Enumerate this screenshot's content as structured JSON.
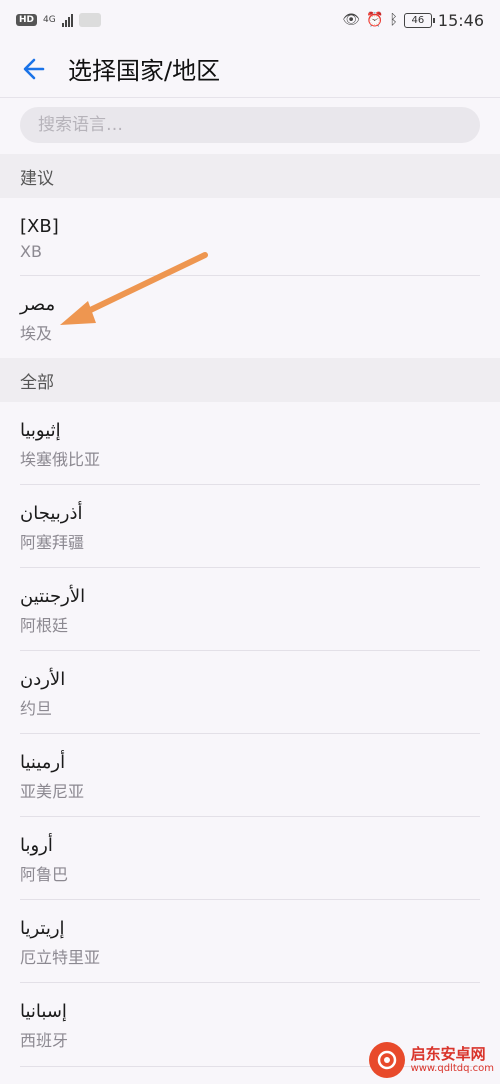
{
  "status_bar": {
    "hd_badge": "HD",
    "network_label": "4G",
    "battery_level": "46",
    "time": "15:46"
  },
  "header": {
    "title": "选择国家/地区"
  },
  "search": {
    "placeholder": "搜索语言…",
    "value": ""
  },
  "sections": {
    "suggested_label": "建议",
    "all_label": "全部"
  },
  "suggested_items": [
    {
      "primary": "[XB]",
      "secondary": "XB"
    },
    {
      "primary": "مصر",
      "secondary": "埃及"
    }
  ],
  "all_items": [
    {
      "primary": "إثيوبيا",
      "secondary": "埃塞俄比亚"
    },
    {
      "primary": "أذربيجان",
      "secondary": "阿塞拜疆"
    },
    {
      "primary": "الأرجنتين",
      "secondary": "阿根廷"
    },
    {
      "primary": "الأردن",
      "secondary": "约旦"
    },
    {
      "primary": "أرمينيا",
      "secondary": "亚美尼亚"
    },
    {
      "primary": "أروبا",
      "secondary": "阿鲁巴"
    },
    {
      "primary": "إريتريا",
      "secondary": "厄立特里亚"
    },
    {
      "primary": "إسبانيا",
      "secondary": "西班牙"
    }
  ],
  "watermark": {
    "title": "启东安卓网",
    "url": "www.qdltdq.com"
  },
  "colors": {
    "accent": "#1a73e8",
    "annotation_arrow": "#ee9650",
    "watermark_red": "#d9342b"
  }
}
